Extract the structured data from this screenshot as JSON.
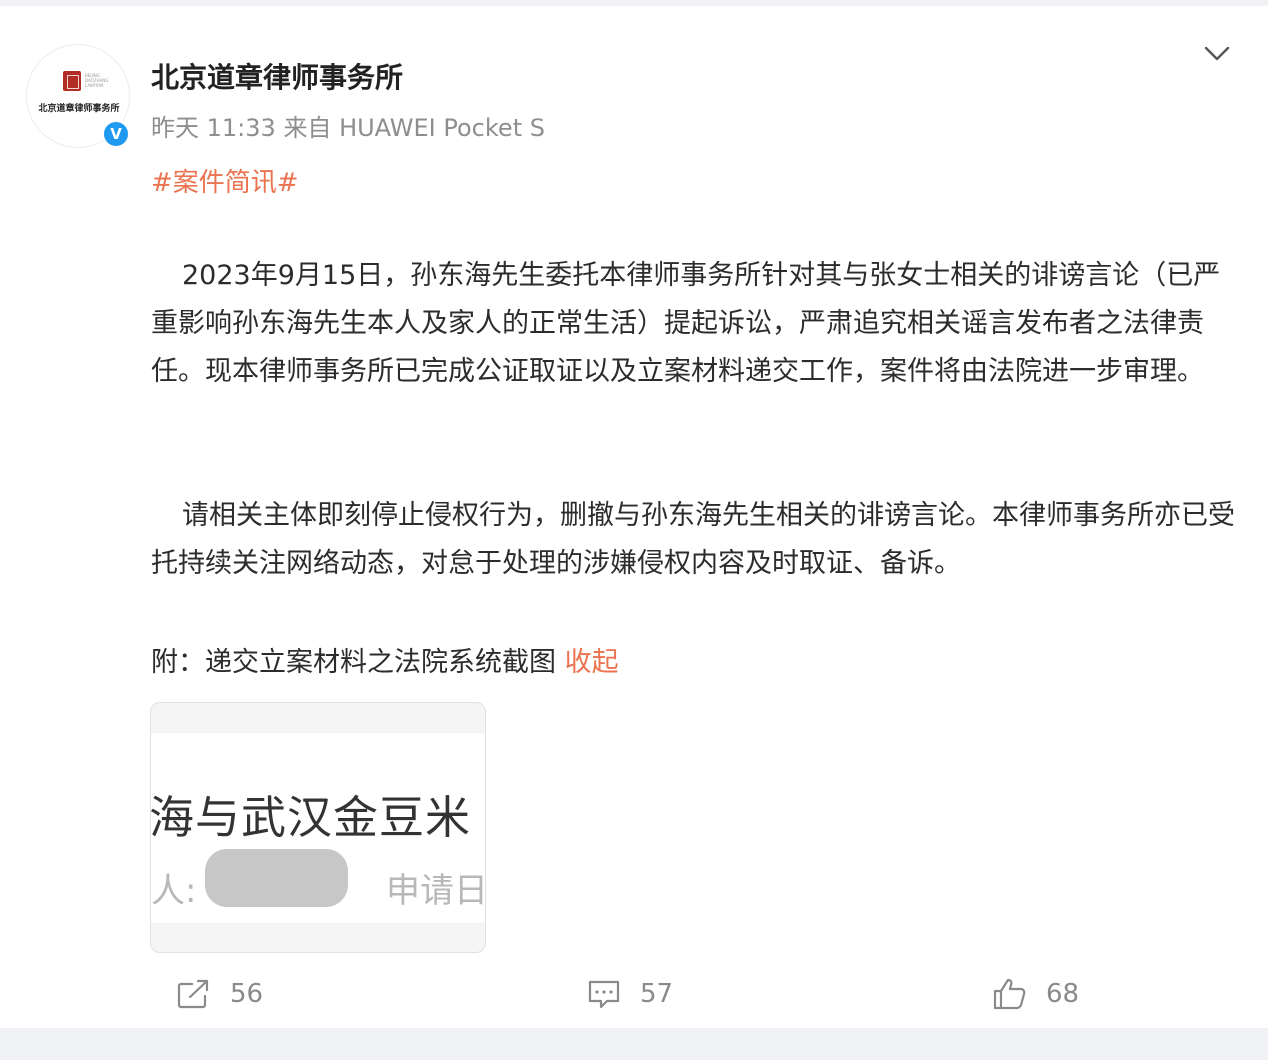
{
  "post": {
    "author": "北京道章律师事务所",
    "avatar_text": "北京道章律师事务所",
    "avatar_english": "BEIJING DAOZHANG LAWFIRM",
    "verified_mark": "V",
    "time": "昨天 11:33",
    "source": "来自 HUAWEI Pocket S",
    "hashtag": "#案件简讯#",
    "paragraph1": "2023年9月15日，孙东海先生委托本律师事务所针对其与张女士相关的诽谤言论（已严重影响孙东海先生本人及家人的正常生活）提起诉讼，严肃追究相关谣言发布者之法律责任。现本律师事务所已完成公证取证以及立案材料递交工作，案件将由法院进一步审理。",
    "paragraph2": "请相关主体即刻停止侵权行为，删撤与孙东海先生相关的诽谤言论。本律师事务所亦已受托持续关注网络动态，对怠于处理的涉嫌侵权内容及时取证、备诉。",
    "attachment_label": "附：递交立案材料之法院系统截图",
    "collapse_label": "收起",
    "image": {
      "line1": "海与武汉金豆米",
      "line2_left": "人:",
      "line2_right": "申请日"
    }
  },
  "actions": {
    "repost_count": "56",
    "comment_count": "57",
    "like_count": "68"
  },
  "colors": {
    "accent": "#eb7350",
    "verified": "#1f9af0",
    "muted": "#8e8e8e"
  },
  "icons": [
    "chevron-down-icon",
    "verified-icon",
    "repost-icon",
    "comment-icon",
    "like-icon"
  ]
}
